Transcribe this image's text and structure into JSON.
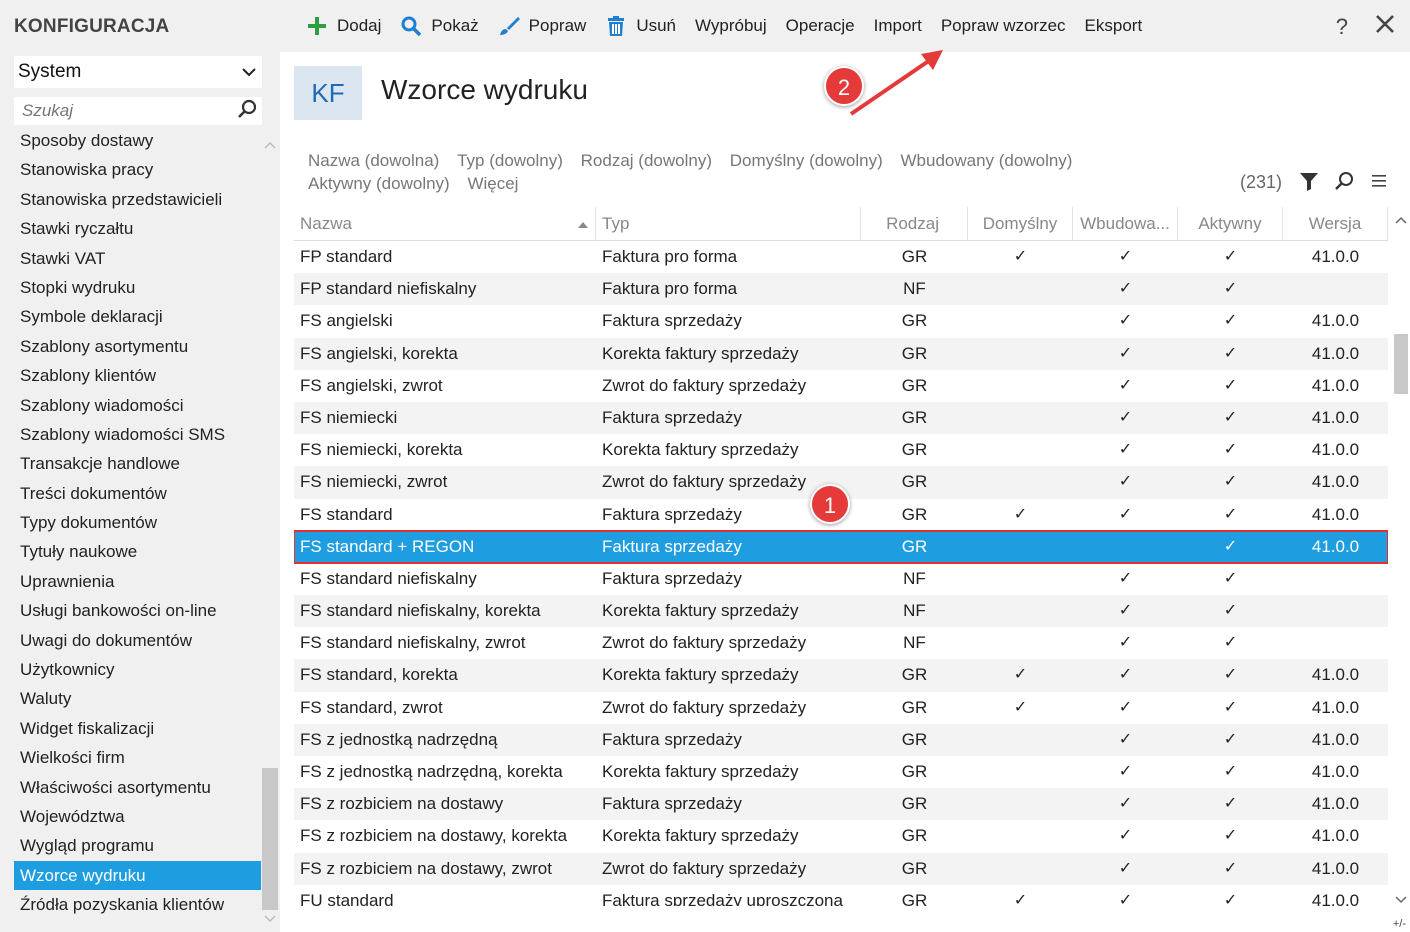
{
  "sidebar": {
    "title": "KONFIGURACJA",
    "select_value": "System",
    "search_placeholder": "Szukaj",
    "items": [
      "Sposoby dostawy",
      "Stanowiska pracy",
      "Stanowiska przedstawicieli",
      "Stawki ryczałtu",
      "Stawki VAT",
      "Stopki wydruku",
      "Symbole deklaracji",
      "Szablony asortymentu",
      "Szablony klientów",
      "Szablony wiadomości",
      "Szablony wiadomości SMS",
      "Transakcje handlowe",
      "Treści dokumentów",
      "Typy dokumentów",
      "Tytuły naukowe",
      "Uprawnienia",
      "Usługi bankowości on-line",
      "Uwagi do dokumentów",
      "Użytkownicy",
      "Waluty",
      "Widget fiskalizacji",
      "Wielkości firm",
      "Właściwości asortymentu",
      "Województwa",
      "Wygląd programu",
      "Wzorce wydruku",
      "Źródła pozyskania klientów"
    ],
    "selected_item": "Wzorce wydruku"
  },
  "toolbar": {
    "add": "Dodaj",
    "show": "Pokaż",
    "edit": "Popraw",
    "delete": "Usuń",
    "try": "Wypróbuj",
    "operations": "Operacje",
    "import": "Import",
    "edit_template": "Popraw wzorzec",
    "export": "Eksport",
    "help": "?",
    "close": "✕"
  },
  "header": {
    "badge": "KF",
    "title": "Wzorce wydruku"
  },
  "filters": [
    "Nazwa (dowolna)",
    "Typ (dowolny)",
    "Rodzaj (dowolny)",
    "Domyślny (dowolny)",
    "Wbudowany (dowolny)",
    "Aktywny (dowolny)",
    "Więcej"
  ],
  "count": "(231)",
  "table": {
    "columns": [
      "Nazwa",
      "Typ",
      "Rodzaj",
      "Domyślny",
      "Wbudowa...",
      "Aktywny",
      "Wersja"
    ],
    "rows": [
      {
        "name": "FP standard",
        "typ": "Faktura pro forma",
        "rodzaj": "GR",
        "dom": "✓",
        "wb": "✓",
        "akt": "✓",
        "ver": "41.0.0"
      },
      {
        "name": "FP standard niefiskalny",
        "typ": "Faktura pro forma",
        "rodzaj": "NF",
        "dom": "",
        "wb": "✓",
        "akt": "✓",
        "ver": ""
      },
      {
        "name": "FS angielski",
        "typ": "Faktura sprzedaży",
        "rodzaj": "GR",
        "dom": "",
        "wb": "✓",
        "akt": "✓",
        "ver": "41.0.0"
      },
      {
        "name": "FS angielski, korekta",
        "typ": "Korekta faktury sprzedaży",
        "rodzaj": "GR",
        "dom": "",
        "wb": "✓",
        "akt": "✓",
        "ver": "41.0.0"
      },
      {
        "name": "FS angielski, zwrot",
        "typ": "Zwrot do faktury sprzedaży",
        "rodzaj": "GR",
        "dom": "",
        "wb": "✓",
        "akt": "✓",
        "ver": "41.0.0"
      },
      {
        "name": "FS niemiecki",
        "typ": "Faktura sprzedaży",
        "rodzaj": "GR",
        "dom": "",
        "wb": "✓",
        "akt": "✓",
        "ver": "41.0.0"
      },
      {
        "name": "FS niemiecki, korekta",
        "typ": "Korekta faktury sprzedaży",
        "rodzaj": "GR",
        "dom": "",
        "wb": "✓",
        "akt": "✓",
        "ver": "41.0.0"
      },
      {
        "name": "FS niemiecki, zwrot",
        "typ": "Zwrot do faktury sprzedaży",
        "rodzaj": "GR",
        "dom": "",
        "wb": "✓",
        "akt": "✓",
        "ver": "41.0.0"
      },
      {
        "name": "FS standard",
        "typ": "Faktura sprzedaży",
        "rodzaj": "GR",
        "dom": "✓",
        "wb": "✓",
        "akt": "✓",
        "ver": "41.0.0"
      },
      {
        "name": "FS standard + REGON",
        "typ": "Faktura sprzedaży",
        "rodzaj": "GR",
        "dom": "",
        "wb": "",
        "akt": "✓",
        "ver": "41.0.0",
        "selected": true
      },
      {
        "name": "FS standard niefiskalny",
        "typ": "Faktura sprzedaży",
        "rodzaj": "NF",
        "dom": "",
        "wb": "✓",
        "akt": "✓",
        "ver": ""
      },
      {
        "name": "FS standard niefiskalny, korekta",
        "typ": "Korekta faktury sprzedaży",
        "rodzaj": "NF",
        "dom": "",
        "wb": "✓",
        "akt": "✓",
        "ver": ""
      },
      {
        "name": "FS standard niefiskalny, zwrot",
        "typ": "Zwrot do faktury sprzedaży",
        "rodzaj": "NF",
        "dom": "",
        "wb": "✓",
        "akt": "✓",
        "ver": ""
      },
      {
        "name": "FS standard, korekta",
        "typ": "Korekta faktury sprzedaży",
        "rodzaj": "GR",
        "dom": "✓",
        "wb": "✓",
        "akt": "✓",
        "ver": "41.0.0"
      },
      {
        "name": "FS standard, zwrot",
        "typ": "Zwrot do faktury sprzedaży",
        "rodzaj": "GR",
        "dom": "✓",
        "wb": "✓",
        "akt": "✓",
        "ver": "41.0.0"
      },
      {
        "name": "FS z jednostką nadrzędną",
        "typ": "Faktura sprzedaży",
        "rodzaj": "GR",
        "dom": "",
        "wb": "✓",
        "akt": "✓",
        "ver": "41.0.0"
      },
      {
        "name": "FS z jednostką nadrzędną, korekta",
        "typ": "Korekta faktury sprzedaży",
        "rodzaj": "GR",
        "dom": "",
        "wb": "✓",
        "akt": "✓",
        "ver": "41.0.0"
      },
      {
        "name": "FS z rozbiciem na dostawy",
        "typ": "Faktura sprzedaży",
        "rodzaj": "GR",
        "dom": "",
        "wb": "✓",
        "akt": "✓",
        "ver": "41.0.0"
      },
      {
        "name": "FS z rozbiciem na dostawy, korekta",
        "typ": "Korekta faktury sprzedaży",
        "rodzaj": "GR",
        "dom": "",
        "wb": "✓",
        "akt": "✓",
        "ver": "41.0.0"
      },
      {
        "name": "FS z rozbiciem na dostawy, zwrot",
        "typ": "Zwrot do faktury sprzedaży",
        "rodzaj": "GR",
        "dom": "",
        "wb": "✓",
        "akt": "✓",
        "ver": "41.0.0"
      },
      {
        "name": "FU standard",
        "typ": "Faktura sprzedaży uproszczona",
        "rodzaj": "GR",
        "dom": "✓",
        "wb": "✓",
        "akt": "✓",
        "ver": "41.0.0"
      }
    ]
  },
  "corner": "+/-",
  "annotations": {
    "marker1": "1",
    "marker2": "2"
  },
  "colors": {
    "accent": "#1e9ee0",
    "highlight": "#e03030",
    "add_icon": "#2e9e3e",
    "toolbar_icon": "#1f7fd1"
  }
}
